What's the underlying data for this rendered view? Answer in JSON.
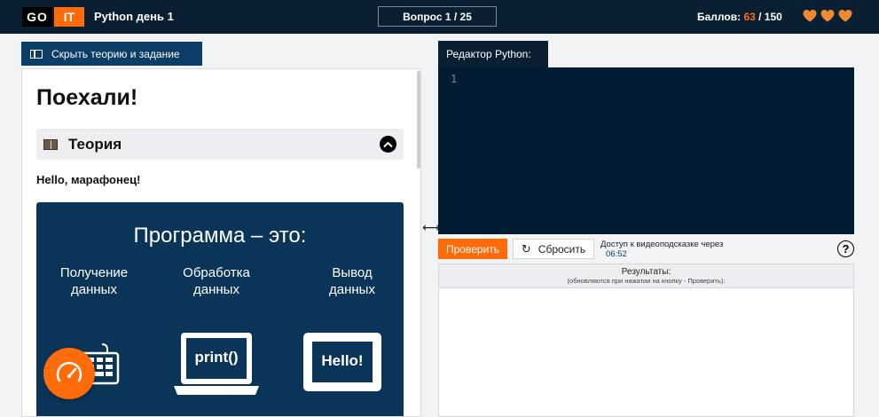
{
  "header": {
    "logo_left": "GO",
    "logo_right": "IT",
    "course_title": "Python день 1",
    "question_counter": "Вопрос 1 / 25",
    "score_label": "Баллов:",
    "score_current": "63",
    "score_total": "/ 150",
    "lives": 3
  },
  "left_panel": {
    "toggle_label": "Скрыть теорию и задание",
    "heading": "Поехали!",
    "accordion_label": "Теория",
    "greeting": "Hello, марафонец!",
    "slide": {
      "title": "Программа – это:",
      "col_input": "Получение данных",
      "col_process": "Обработка данных",
      "col_output": "Вывод данных",
      "laptop_text": "print()",
      "monitor_text": "Hello!"
    }
  },
  "editor": {
    "tab_label": "Редактор Python:",
    "line_number": "1"
  },
  "actions": {
    "check_label": "Проверить",
    "reset_label": "Сбросить",
    "hint_text": "Доступ к видеоподсказке через",
    "hint_time": "06:52",
    "help_label": "?"
  },
  "results": {
    "title": "Результаты:",
    "subtitle": "(обновляются при нажатии на кнопку - Проверить):"
  },
  "colors": {
    "accent": "#ff6b08",
    "header_bg": "#0b1f33",
    "editor_bg": "#031a33",
    "slide_bg": "#0b3558"
  }
}
